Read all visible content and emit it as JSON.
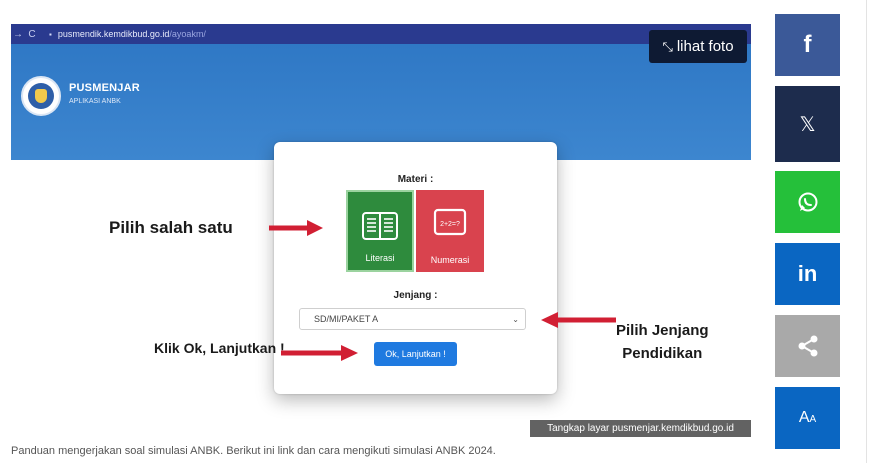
{
  "browser": {
    "url_domain": "pusmendik.kemdikbud.go.id",
    "url_path": "/ayoakm/"
  },
  "app": {
    "brand_title": "PUSMENJAR",
    "brand_subtitle": "APLIKASI ANBK"
  },
  "photo": {
    "view_button_label": "lihat foto",
    "credit_badge": "Tangkap layar pusmenjar.kemdikbud.go.id"
  },
  "modal": {
    "materi_label": "Materi :",
    "options": [
      {
        "label": "Literasi",
        "color": "#2e8b3d",
        "selected": true
      },
      {
        "label": "Numerasi",
        "color": "#d9434e",
        "selected": false
      }
    ],
    "numerasi_icon_text": "2+2=?",
    "jenjang_label": "Jenjang :",
    "jenjang_selected": "SD/MI/PAKET A",
    "submit_label": "Ok, Lanjutkan !"
  },
  "annotations": {
    "choose_one": "Pilih salah satu",
    "choose_level_line1": "Pilih Jenjang",
    "choose_level_line2": "Pendidikan",
    "click_ok": "Klik Ok, Lanjutkan !"
  },
  "caption": "Panduan mengerjakan soal simulasi ANBK. Berikut ini link dan cara mengikuti simulasi ANBK 2024.",
  "share": {
    "buttons": [
      {
        "network": "facebook",
        "glyph": "f",
        "color": "#3b5998"
      },
      {
        "network": "x",
        "glyph": "𝕏",
        "color": "#1d2c4d"
      },
      {
        "network": "whatsapp",
        "glyph": "",
        "color": "#25c03a"
      },
      {
        "network": "linkedin",
        "glyph": "in",
        "color": "#0a66c2"
      },
      {
        "network": "share",
        "glyph": "",
        "color": "#a9a9a9"
      },
      {
        "network": "text-size",
        "glyph_main": "A",
        "glyph_sub": "A",
        "color": "#0a66c2"
      }
    ]
  },
  "colors": {
    "banner": "#2f78c5",
    "browser_bar": "#2a3a8f",
    "arrow": "#d11f33",
    "button_blue": "#1f7ae0"
  }
}
